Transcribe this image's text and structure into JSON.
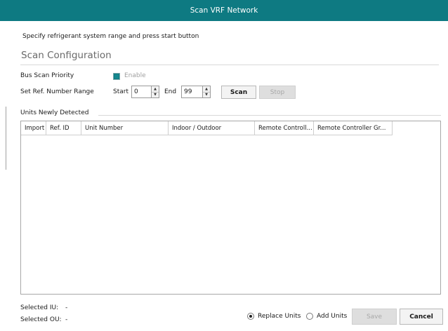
{
  "window": {
    "title": "Scan VRF Network"
  },
  "instruction": "Specify refrigerant system range and press start button",
  "scan_config": {
    "title": "Scan Configuration",
    "bus_scan_priority_label": "Bus Scan Priority",
    "enable_label": "Enable",
    "enable_checked": true,
    "range_label": "Set Ref. Number Range",
    "start_label": "Start",
    "start_value": "0",
    "end_label": "End",
    "end_value": "99",
    "scan_button": "Scan",
    "stop_button": "Stop"
  },
  "units": {
    "label": "Units Newly Detected",
    "columns": [
      "Import",
      "Ref. ID",
      "Unit Number",
      "Indoor / Outdoor",
      "Remote Controll...",
      "Remote Controller Gr..."
    ],
    "rows": []
  },
  "footer": {
    "selected_iu_label": "Selected IU:",
    "selected_iu_value": "-",
    "selected_ou_label": "Selected OU:",
    "selected_ou_value": "-",
    "replace_units_label": "Replace Units",
    "add_units_label": "Add Units",
    "selected_mode": "replace",
    "save_button": "Save",
    "cancel_button": "Cancel"
  },
  "colors": {
    "accent": "#0e7a82"
  }
}
